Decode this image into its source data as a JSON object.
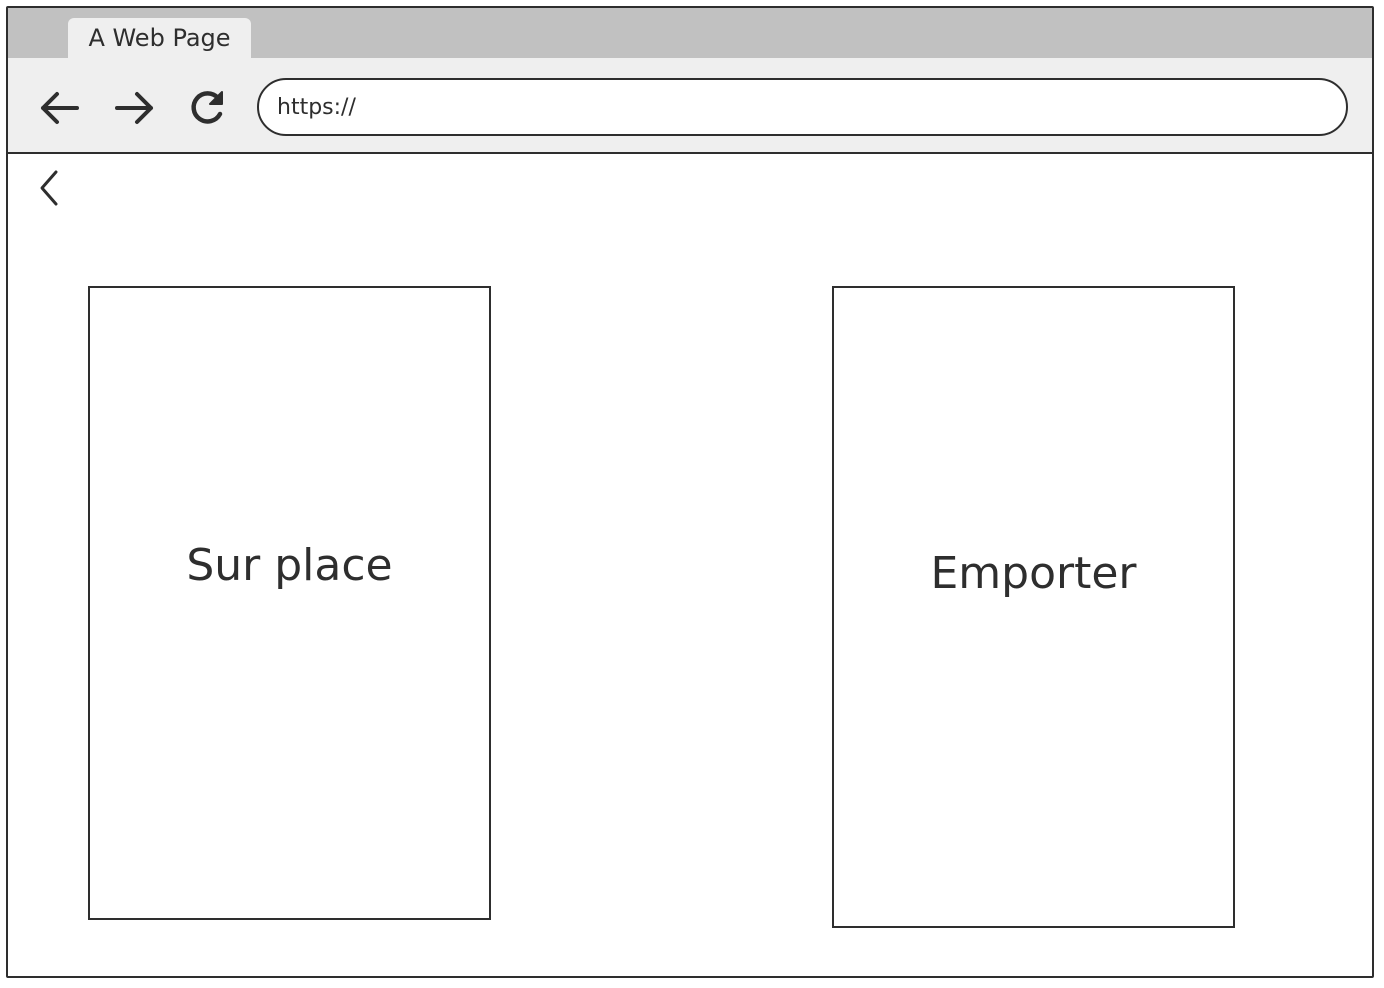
{
  "browser": {
    "tab_title": "A Web Page",
    "address_value": "https://",
    "icons": {
      "back": "arrow-left-icon",
      "forward": "arrow-right-icon",
      "reload": "reload-icon"
    }
  },
  "page": {
    "back_icon": "chevron-left-icon",
    "options": [
      {
        "label": "Sur place"
      },
      {
        "label": "Emporter"
      }
    ]
  },
  "colors": {
    "ink": "#2e2e2e",
    "tabbar": "#c1c1c1",
    "toolbar": "#efefef",
    "background": "#ffffff"
  }
}
